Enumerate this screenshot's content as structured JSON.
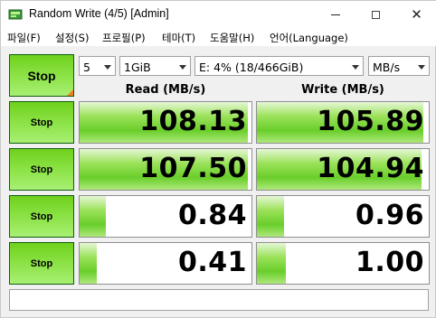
{
  "window": {
    "title": "Random Write (4/5) [Admin]"
  },
  "menu": [
    "파일(F)",
    "설정(S)",
    "프로필(P)",
    "테마(T)",
    "도움말(H)",
    "언어(Language)"
  ],
  "controls": {
    "all_button_label": "Stop",
    "count": "5",
    "size": "1GiB",
    "drive": "E: 4% (18/466GiB)",
    "unit": "MB/s"
  },
  "headers": {
    "read": "Read (MB/s)",
    "write": "Write (MB/s)"
  },
  "rows": [
    {
      "button": "Stop",
      "read": "108.13",
      "write": "105.89",
      "read_level": 0.98,
      "write_level": 0.97
    },
    {
      "button": "Stop",
      "read": "107.50",
      "write": "104.94",
      "read_level": 0.98,
      "write_level": 0.96
    },
    {
      "button": "Stop",
      "read": "0.84",
      "write": "0.96",
      "read_level": 0.15,
      "write_level": 0.16
    },
    {
      "button": "Stop",
      "read": "0.41",
      "write": "1.00",
      "read_level": 0.1,
      "write_level": 0.17
    }
  ],
  "comment": "",
  "colors": {
    "button_green": "#7fdc33",
    "button_border": "#0e5e0e",
    "meter_green": "#69ce2a",
    "corner_orange": "#f08020"
  },
  "icons": {
    "app": "disk-gauge-icon",
    "minimize": "minimize-icon",
    "maximize": "maximize-icon",
    "close": "close-icon",
    "dropdown": "chevron-down-icon"
  }
}
